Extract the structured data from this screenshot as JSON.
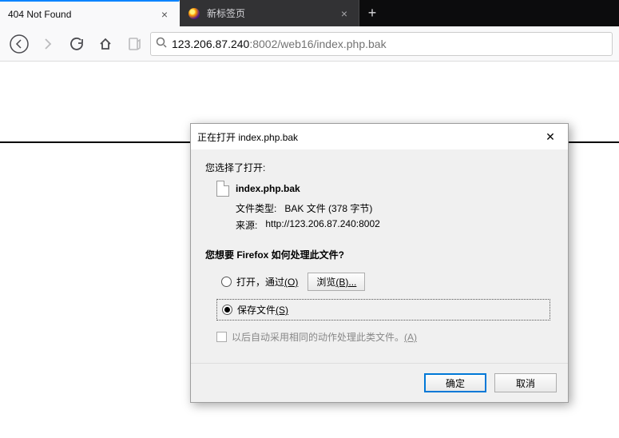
{
  "tabs": [
    {
      "title": "404 Not Found"
    },
    {
      "title": "新标签页"
    }
  ],
  "url": {
    "host": "123.206.87.240",
    "rest": ":8002/web16/index.php.bak"
  },
  "dialog": {
    "title": "正在打开 index.php.bak",
    "you_chose": "您选择了打开:",
    "filename": "index.php.bak",
    "filetype_label": "文件类型:",
    "filetype_value": "BAK 文件 (378 字节)",
    "source_label": "来源:",
    "source_value": "http://123.206.87.240:8002",
    "question": "您想要 Firefox 如何处理此文件?",
    "open_with": "打开，通过",
    "open_with_key": "(O)",
    "browse": "浏览",
    "browse_key": "(B)...",
    "save_file": "保存文件",
    "save_file_key": "(S)",
    "remember": "以后自动采用相同的动作处理此类文件。",
    "remember_key": "(A)",
    "ok": "确定",
    "cancel": "取消"
  }
}
